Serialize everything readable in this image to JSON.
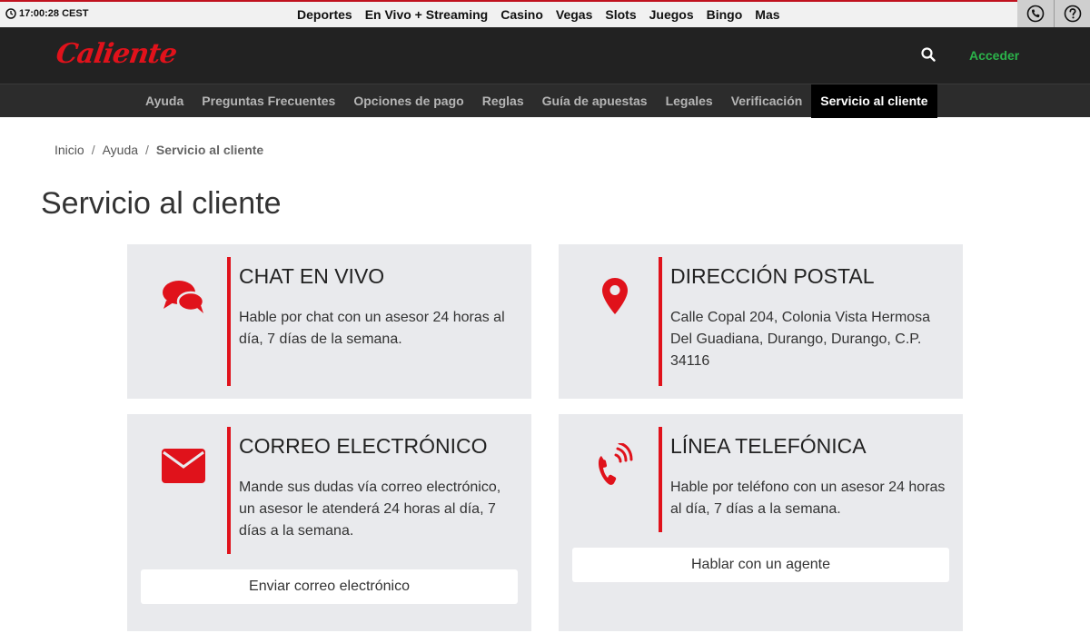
{
  "topbar": {
    "clock": "17:00:28 CEST",
    "nav": [
      "Deportes",
      "En Vivo + Streaming",
      "Casino",
      "Vegas",
      "Slots",
      "Juegos",
      "Bingo",
      "Mas"
    ]
  },
  "header": {
    "logo_text": "Caliente",
    "login_label": "Acceder"
  },
  "subnav": [
    "Ayuda",
    "Preguntas Frecuentes",
    "Opciones de pago",
    "Reglas",
    "Guía de apuestas",
    "Legales",
    "Verificación",
    "Servicio al cliente"
  ],
  "breadcrumb": [
    "Inicio",
    "Ayuda",
    "Servicio al cliente"
  ],
  "page_title": "Servicio al cliente",
  "cards": [
    {
      "title": "CHAT EN VIVO",
      "text": "Hable por chat con un asesor 24 horas al día, 7 días de la semana.",
      "icon": "chat-bubbles-icon"
    },
    {
      "title": "DIRECCIÓN POSTAL",
      "text": "Calle Copal 204, Colonia Vista Hermosa Del Guadiana, Durango, Durango, C.P. 34116",
      "icon": "map-pin-icon"
    },
    {
      "title": "CORREO ELECTRÓNICO",
      "text": "Mande sus dudas vía correo electrónico, un asesor le atenderá 24 horas al día, 7 días a la semana.",
      "button": "Enviar correo electrónico",
      "icon": "envelope-icon"
    },
    {
      "title": "LÍNEA TELEFÓNICA",
      "text": "Hable por teléfono con un asesor 24 horas al día, 7 días a la semana.",
      "button": "Hablar con un agente",
      "icon": "phone-ringing-icon"
    }
  ],
  "colors": {
    "accent_red": "#e0121b",
    "login_green": "#2bb34a",
    "header_bg": "#222222",
    "card_bg": "#e9eaed"
  }
}
